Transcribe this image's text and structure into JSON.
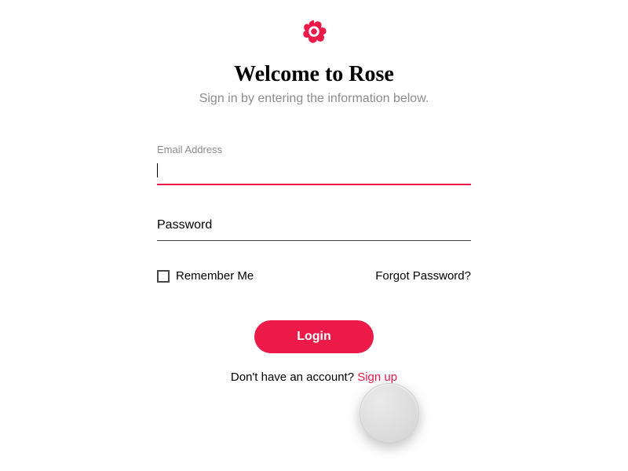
{
  "brand": {
    "title": "Welcome to Rose",
    "subtitle": "Sign in by entering the information below.",
    "accent_color": "#ec1a49"
  },
  "form": {
    "email": {
      "label": "Email Address",
      "value": ""
    },
    "password": {
      "placeholder": "Password",
      "value": ""
    },
    "remember": {
      "label": "Remember Me",
      "checked": false
    },
    "forgot_label": "Forgot Password?",
    "login_button": "Login"
  },
  "signup": {
    "prompt": "Don't have an account? ",
    "link_label": "Sign up"
  }
}
